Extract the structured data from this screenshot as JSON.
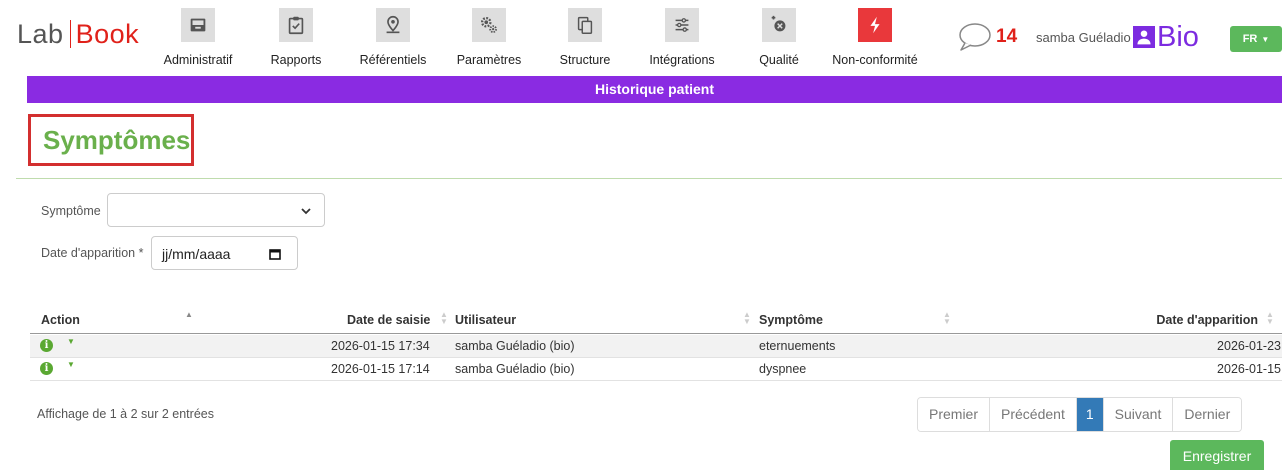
{
  "logo": {
    "part1": "Lab",
    "part2": "Book"
  },
  "nav": {
    "items": [
      {
        "label": "Administratif"
      },
      {
        "label": "Rapports"
      },
      {
        "label": "Référentiels"
      },
      {
        "label": "Paramètres"
      },
      {
        "label": "Structure"
      },
      {
        "label": "Intégrations"
      },
      {
        "label": "Qualité"
      },
      {
        "label": "Non-conformité"
      }
    ],
    "notification_count": "14",
    "user_name": "samba Guéladio",
    "bio_label": "Bio",
    "language": "FR"
  },
  "banner": {
    "title": "Historique patient"
  },
  "page": {
    "title": "Symptômes"
  },
  "form": {
    "symptom_label": "Symptôme",
    "symptom_value": "",
    "date_label": "Date d'apparition *",
    "date_placeholder": "jj/mm/aaaa"
  },
  "table": {
    "columns": [
      "Action",
      "Date de saisie",
      "Utilisateur",
      "Symptôme",
      "Date d'apparition"
    ],
    "rows": [
      {
        "date_saisie": "2026-01-15 17:34",
        "utilisateur": "samba Guéladio (bio)",
        "symptome": "eternuements",
        "date_apparition": "2026-01-23"
      },
      {
        "date_saisie": "2026-01-15 17:14",
        "utilisateur": "samba Guéladio (bio)",
        "symptome": "dyspnee",
        "date_apparition": "2026-01-15"
      }
    ],
    "info": "Affichage de 1 à 2 sur 2 entrées"
  },
  "pagination": {
    "first": "Premier",
    "prev": "Précédent",
    "current": "1",
    "next": "Suivant",
    "last": "Dernier"
  },
  "actions": {
    "save": "Enregistrer"
  },
  "colors": {
    "brand_red": "#e0211a",
    "purple": "#8a2be2",
    "title_green": "#6ab04c",
    "button_green": "#5cb85c",
    "page_blue": "#337ab7"
  }
}
